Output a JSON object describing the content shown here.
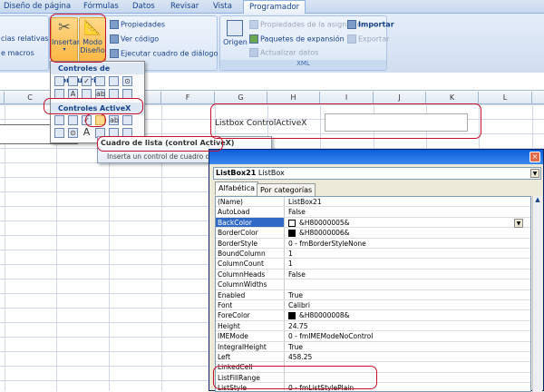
{
  "ribbon": {
    "tabs": [
      "Diseño de página",
      "Fórmulas",
      "Datos",
      "Revisar",
      "Vista",
      "Programador"
    ],
    "active_tab": "Programador",
    "code_group": {
      "items": [
        "cias relativas",
        "e macros"
      ]
    },
    "controls_group": {
      "insert": "Insertar",
      "design_mode": [
        "Modo",
        "Diseño"
      ],
      "properties": "Propiedades",
      "view_code": "Ver código",
      "run_dialog": "Ejecutar cuadro de diálogo"
    },
    "xml_group": {
      "label": "XML",
      "source": "Origen",
      "map_properties": "Propiedades de la asignación",
      "expansion_packs": "Paquetes de expansión",
      "refresh_data": "Actualizar datos",
      "import": "Importar",
      "export": "Exportar"
    }
  },
  "insert_menu": {
    "form_controls_header": "Controles de formulario",
    "activex_header": "Controles ActiveX"
  },
  "tooltip": {
    "title": "Cuadro de lista (control ActiveX)",
    "description": "Inserta un control de cuadro de lista."
  },
  "sheet": {
    "columns": [
      "C",
      "D",
      "E",
      "F",
      "G",
      "H",
      "I",
      "J",
      "K",
      "L"
    ],
    "cell_label": "Listbox ControlActiveX"
  },
  "properties": {
    "object_name": "ListBox21",
    "object_type": "ListBox",
    "tabs": [
      "Alfabética",
      "Por categorías"
    ],
    "rows": [
      {
        "name": "(Name)",
        "value": "ListBox21"
      },
      {
        "name": "AutoLoad",
        "value": "False"
      },
      {
        "name": "BackColor",
        "value": "&H80000005&",
        "swatch": "#ffffff",
        "selected": true
      },
      {
        "name": "BorderColor",
        "value": "&H80000006&",
        "swatch": "#000000"
      },
      {
        "name": "BorderStyle",
        "value": "0 - fmBorderStyleNone"
      },
      {
        "name": "BoundColumn",
        "value": "1"
      },
      {
        "name": "ColumnCount",
        "value": "1"
      },
      {
        "name": "ColumnHeads",
        "value": "False"
      },
      {
        "name": "ColumnWidths",
        "value": ""
      },
      {
        "name": "Enabled",
        "value": "True"
      },
      {
        "name": "Font",
        "value": "Calibri"
      },
      {
        "name": "ForeColor",
        "value": "&H80000008&",
        "swatch": "#000000"
      },
      {
        "name": "Height",
        "value": "24.75"
      },
      {
        "name": "IMEMode",
        "value": "0 - fmIMEModeNoControl"
      },
      {
        "name": "IntegralHeight",
        "value": "True"
      },
      {
        "name": "Left",
        "value": "458.25"
      },
      {
        "name": "LinkedCell",
        "value": ""
      },
      {
        "name": "ListFillRange",
        "value": ""
      },
      {
        "name": "ListStyle",
        "value": "0 - fmListStylePlain"
      }
    ]
  },
  "colors": {
    "highlight": "#c8102e",
    "selection": "#316ac5"
  }
}
